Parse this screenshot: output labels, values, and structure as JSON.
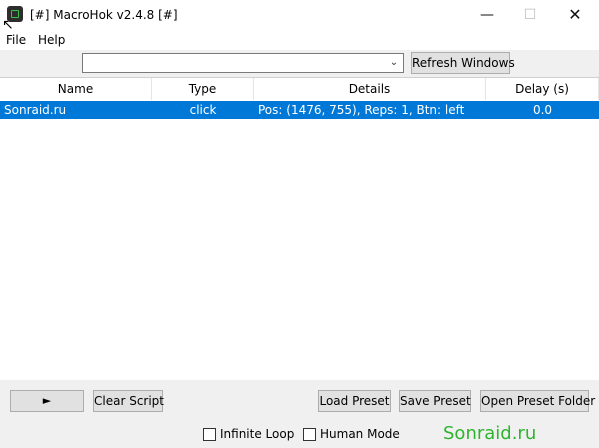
{
  "window": {
    "title": "[#] MacroHok v2.4.8 [#]",
    "minimize_glyph": "—",
    "maximize_glyph": "☐",
    "close_glyph": "✕"
  },
  "menu": {
    "file": "File",
    "help": "Help"
  },
  "window_select": {
    "value": "",
    "arrow_glyph": "⌄"
  },
  "toolbar": {
    "refresh_label": "Refresh Windows"
  },
  "table": {
    "headers": {
      "name": "Name",
      "type": "Type",
      "details": "Details",
      "delay": "Delay (s)"
    },
    "rows": [
      {
        "name": "Sonraid.ru",
        "type": "click",
        "details": "Pos: (1476, 755), Reps: 1, Btn: left",
        "delay": "0.0",
        "selected": true
      }
    ]
  },
  "controls": {
    "play_label": "►",
    "clear_label": "Clear Script",
    "load_label": "Load Preset",
    "save_label": "Save Preset",
    "open_folder_label": "Open Preset Folder",
    "infinite_loop_label": "Infinite Loop",
    "infinite_loop_checked": false,
    "human_mode_label": "Human Mode",
    "human_mode_checked": false
  },
  "watermark": {
    "text": "Sonraid.ru",
    "color": "#2db52d"
  },
  "colors": {
    "selection": "#0078d7"
  }
}
